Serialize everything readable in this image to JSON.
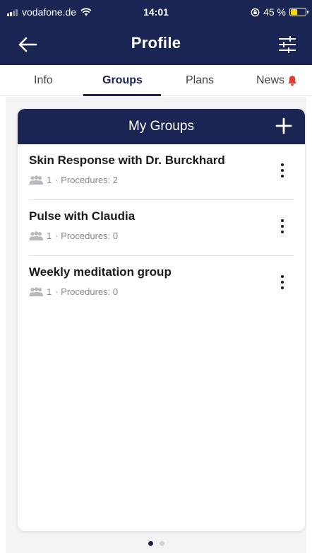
{
  "status_bar": {
    "carrier": "vodafone.de",
    "time": "14:01",
    "battery": "45 %",
    "battery_level": 0.45,
    "icons": [
      "signal-icon",
      "wifi-icon",
      "orientation-lock-icon",
      "battery-icon"
    ]
  },
  "header": {
    "title": "Profile",
    "back_icon": "back-arrow-icon",
    "filter_icon": "sliders-icon"
  },
  "tabs": [
    {
      "label": "Info",
      "active": false
    },
    {
      "label": "Groups",
      "active": true
    },
    {
      "label": "Plans",
      "active": false
    },
    {
      "label": "News",
      "active": false,
      "icon": "bell-icon"
    }
  ],
  "card": {
    "title": "My Groups",
    "add_icon": "plus-icon"
  },
  "groups": [
    {
      "name": "Skin Response with Dr. Burckhard",
      "members": "1",
      "procedures": "· Procedures: 2"
    },
    {
      "name": "Pulse with Claudia",
      "members": "1",
      "procedures": "· Procedures: 0"
    },
    {
      "name": "Weekly meditation group",
      "members": "1",
      "procedures": "· Procedures: 0"
    }
  ],
  "pager": {
    "pages": 2,
    "current": 1
  },
  "colors": {
    "primary": "#1b2553",
    "accent": "#e8382f",
    "battery": "#f5d90a"
  }
}
